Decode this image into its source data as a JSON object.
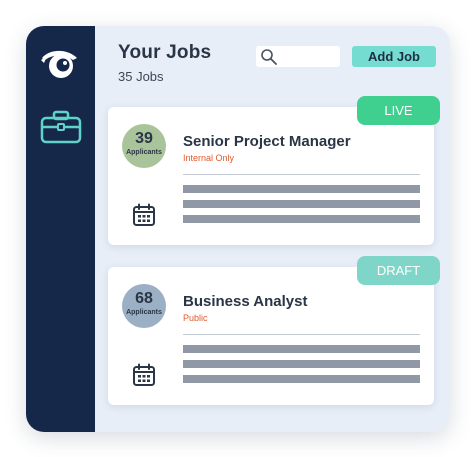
{
  "header": {
    "title": "Your Jobs",
    "count": "35 Jobs",
    "add_label": "Add Job",
    "search_placeholder": ""
  },
  "jobs": [
    {
      "applicants": "39",
      "applicants_label": "Applicants",
      "title": "Senior Project Manager",
      "visibility": "Internal Only",
      "status": "LIVE"
    },
    {
      "applicants": "68",
      "applicants_label": "Applicants",
      "title": "Business Analyst",
      "visibility": "Public",
      "status": "DRAFT"
    }
  ],
  "colors": {
    "sidebar": "#16284a",
    "background": "#e8eef8",
    "accent": "#74dcd0",
    "live": "#3fcf8e",
    "draft": "#7fd6c8",
    "badge_internal": "#a9c49a",
    "badge_public": "#9bb0c4",
    "warning_text": "#e05a2f"
  },
  "icons": {
    "logo": "eye-logo-icon",
    "jobs_nav": "briefcase-icon",
    "search": "search-icon",
    "calendar": "calendar-icon"
  }
}
